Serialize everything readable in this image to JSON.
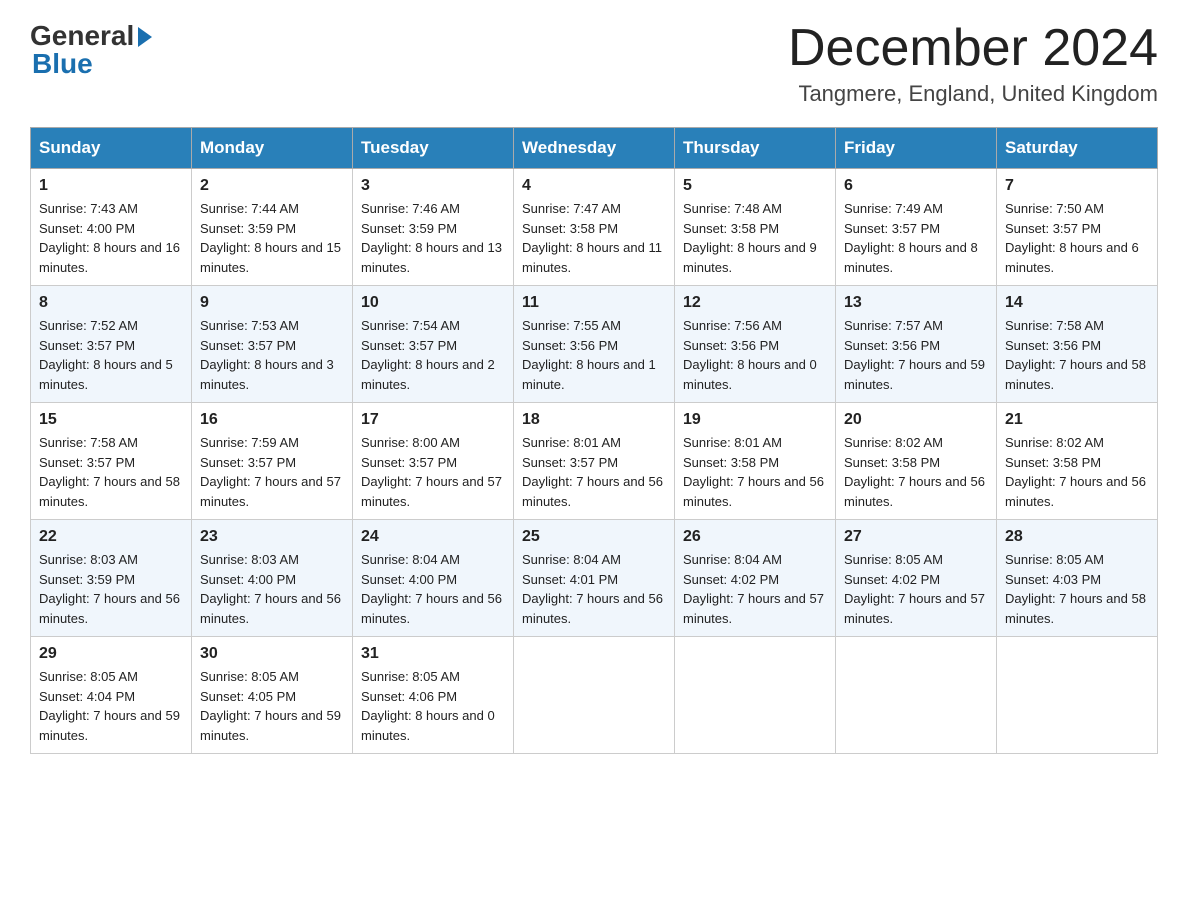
{
  "header": {
    "logo_general": "General",
    "logo_blue": "Blue",
    "month_title": "December 2024",
    "location": "Tangmere, England, United Kingdom"
  },
  "days_of_week": [
    "Sunday",
    "Monday",
    "Tuesday",
    "Wednesday",
    "Thursday",
    "Friday",
    "Saturday"
  ],
  "weeks": [
    [
      {
        "day": "1",
        "sunrise": "Sunrise: 7:43 AM",
        "sunset": "Sunset: 4:00 PM",
        "daylight": "Daylight: 8 hours and 16 minutes."
      },
      {
        "day": "2",
        "sunrise": "Sunrise: 7:44 AM",
        "sunset": "Sunset: 3:59 PM",
        "daylight": "Daylight: 8 hours and 15 minutes."
      },
      {
        "day": "3",
        "sunrise": "Sunrise: 7:46 AM",
        "sunset": "Sunset: 3:59 PM",
        "daylight": "Daylight: 8 hours and 13 minutes."
      },
      {
        "day": "4",
        "sunrise": "Sunrise: 7:47 AM",
        "sunset": "Sunset: 3:58 PM",
        "daylight": "Daylight: 8 hours and 11 minutes."
      },
      {
        "day": "5",
        "sunrise": "Sunrise: 7:48 AM",
        "sunset": "Sunset: 3:58 PM",
        "daylight": "Daylight: 8 hours and 9 minutes."
      },
      {
        "day": "6",
        "sunrise": "Sunrise: 7:49 AM",
        "sunset": "Sunset: 3:57 PM",
        "daylight": "Daylight: 8 hours and 8 minutes."
      },
      {
        "day": "7",
        "sunrise": "Sunrise: 7:50 AM",
        "sunset": "Sunset: 3:57 PM",
        "daylight": "Daylight: 8 hours and 6 minutes."
      }
    ],
    [
      {
        "day": "8",
        "sunrise": "Sunrise: 7:52 AM",
        "sunset": "Sunset: 3:57 PM",
        "daylight": "Daylight: 8 hours and 5 minutes."
      },
      {
        "day": "9",
        "sunrise": "Sunrise: 7:53 AM",
        "sunset": "Sunset: 3:57 PM",
        "daylight": "Daylight: 8 hours and 3 minutes."
      },
      {
        "day": "10",
        "sunrise": "Sunrise: 7:54 AM",
        "sunset": "Sunset: 3:57 PM",
        "daylight": "Daylight: 8 hours and 2 minutes."
      },
      {
        "day": "11",
        "sunrise": "Sunrise: 7:55 AM",
        "sunset": "Sunset: 3:56 PM",
        "daylight": "Daylight: 8 hours and 1 minute."
      },
      {
        "day": "12",
        "sunrise": "Sunrise: 7:56 AM",
        "sunset": "Sunset: 3:56 PM",
        "daylight": "Daylight: 8 hours and 0 minutes."
      },
      {
        "day": "13",
        "sunrise": "Sunrise: 7:57 AM",
        "sunset": "Sunset: 3:56 PM",
        "daylight": "Daylight: 7 hours and 59 minutes."
      },
      {
        "day": "14",
        "sunrise": "Sunrise: 7:58 AM",
        "sunset": "Sunset: 3:56 PM",
        "daylight": "Daylight: 7 hours and 58 minutes."
      }
    ],
    [
      {
        "day": "15",
        "sunrise": "Sunrise: 7:58 AM",
        "sunset": "Sunset: 3:57 PM",
        "daylight": "Daylight: 7 hours and 58 minutes."
      },
      {
        "day": "16",
        "sunrise": "Sunrise: 7:59 AM",
        "sunset": "Sunset: 3:57 PM",
        "daylight": "Daylight: 7 hours and 57 minutes."
      },
      {
        "day": "17",
        "sunrise": "Sunrise: 8:00 AM",
        "sunset": "Sunset: 3:57 PM",
        "daylight": "Daylight: 7 hours and 57 minutes."
      },
      {
        "day": "18",
        "sunrise": "Sunrise: 8:01 AM",
        "sunset": "Sunset: 3:57 PM",
        "daylight": "Daylight: 7 hours and 56 minutes."
      },
      {
        "day": "19",
        "sunrise": "Sunrise: 8:01 AM",
        "sunset": "Sunset: 3:58 PM",
        "daylight": "Daylight: 7 hours and 56 minutes."
      },
      {
        "day": "20",
        "sunrise": "Sunrise: 8:02 AM",
        "sunset": "Sunset: 3:58 PM",
        "daylight": "Daylight: 7 hours and 56 minutes."
      },
      {
        "day": "21",
        "sunrise": "Sunrise: 8:02 AM",
        "sunset": "Sunset: 3:58 PM",
        "daylight": "Daylight: 7 hours and 56 minutes."
      }
    ],
    [
      {
        "day": "22",
        "sunrise": "Sunrise: 8:03 AM",
        "sunset": "Sunset: 3:59 PM",
        "daylight": "Daylight: 7 hours and 56 minutes."
      },
      {
        "day": "23",
        "sunrise": "Sunrise: 8:03 AM",
        "sunset": "Sunset: 4:00 PM",
        "daylight": "Daylight: 7 hours and 56 minutes."
      },
      {
        "day": "24",
        "sunrise": "Sunrise: 8:04 AM",
        "sunset": "Sunset: 4:00 PM",
        "daylight": "Daylight: 7 hours and 56 minutes."
      },
      {
        "day": "25",
        "sunrise": "Sunrise: 8:04 AM",
        "sunset": "Sunset: 4:01 PM",
        "daylight": "Daylight: 7 hours and 56 minutes."
      },
      {
        "day": "26",
        "sunrise": "Sunrise: 8:04 AM",
        "sunset": "Sunset: 4:02 PM",
        "daylight": "Daylight: 7 hours and 57 minutes."
      },
      {
        "day": "27",
        "sunrise": "Sunrise: 8:05 AM",
        "sunset": "Sunset: 4:02 PM",
        "daylight": "Daylight: 7 hours and 57 minutes."
      },
      {
        "day": "28",
        "sunrise": "Sunrise: 8:05 AM",
        "sunset": "Sunset: 4:03 PM",
        "daylight": "Daylight: 7 hours and 58 minutes."
      }
    ],
    [
      {
        "day": "29",
        "sunrise": "Sunrise: 8:05 AM",
        "sunset": "Sunset: 4:04 PM",
        "daylight": "Daylight: 7 hours and 59 minutes."
      },
      {
        "day": "30",
        "sunrise": "Sunrise: 8:05 AM",
        "sunset": "Sunset: 4:05 PM",
        "daylight": "Daylight: 7 hours and 59 minutes."
      },
      {
        "day": "31",
        "sunrise": "Sunrise: 8:05 AM",
        "sunset": "Sunset: 4:06 PM",
        "daylight": "Daylight: 8 hours and 0 minutes."
      },
      null,
      null,
      null,
      null
    ]
  ]
}
